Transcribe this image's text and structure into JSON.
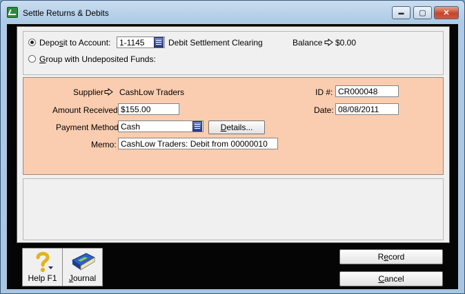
{
  "window": {
    "title": "Settle Returns & Debits",
    "controls": {
      "minimize": "▬",
      "maximize": "▢",
      "close": "✕"
    }
  },
  "deposit": {
    "deposit_label_pre": "Depo",
    "deposit_label_ul": "s",
    "deposit_label_post": "it to Account:",
    "account_code": "1-1145",
    "account_name": "Debit Settlement Clearing",
    "balance_label": "Balance",
    "balance_value": "$0.00",
    "group_label_ul": "G",
    "group_label_post": "roup with Undeposited Funds:",
    "deposit_selected": true
  },
  "details": {
    "supplier_label": "Supplier",
    "supplier_value": "CashLow Traders",
    "amount_label": "Amount Received:",
    "amount_value": "$155.00",
    "payment_method_label": "Payment Method:",
    "payment_method_value": "Cash",
    "details_button_pre": "",
    "details_button_ul": "D",
    "details_button_post": "etails...",
    "memo_label": "Memo:",
    "memo_value": "CashLow Traders:  Debit from 00000010",
    "id_label": "ID #:",
    "id_value": "CR000048",
    "date_label": "Date:",
    "date_value": "08/08/2011"
  },
  "toolbar": {
    "help_label": "Help F1",
    "journal_label_ul": "J",
    "journal_label_post": "ournal"
  },
  "actions": {
    "record_label_pre": "R",
    "record_label_ul": "e",
    "record_label_post": "cord",
    "cancel_label_ul": "C",
    "cancel_label_post": "ancel"
  },
  "colors": {
    "details_panel_bg": "#facdb0",
    "frame_dark": "#050505",
    "combo_button": "#2a3d9a"
  }
}
